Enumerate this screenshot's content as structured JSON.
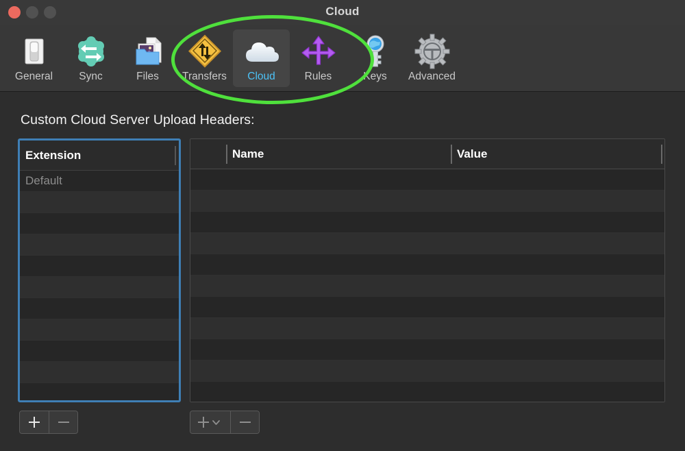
{
  "window": {
    "title": "Cloud",
    "traffic_lights": [
      {
        "name": "close-button",
        "color": "#ec6a5f"
      },
      {
        "name": "minimize-button",
        "color": "#515151"
      },
      {
        "name": "maximize-button",
        "color": "#515151"
      }
    ]
  },
  "toolbar": {
    "tabs": [
      {
        "label": "General",
        "icon": "switch-icon",
        "selected": false
      },
      {
        "label": "Sync",
        "icon": "sync-icon",
        "selected": false
      },
      {
        "label": "Files",
        "icon": "files-icon",
        "selected": false
      },
      {
        "label": "Transfers",
        "icon": "transfers-icon",
        "selected": false
      },
      {
        "label": "Cloud",
        "icon": "cloud-icon",
        "selected": true
      },
      {
        "label": "Rules",
        "icon": "rules-icon",
        "selected": false
      },
      {
        "label": "Keys",
        "icon": "keys-icon",
        "selected": false
      },
      {
        "label": "Advanced",
        "icon": "gear-icon",
        "selected": false
      }
    ],
    "selected_tab_label": "Cloud",
    "selected_tab_text_color": "#4cc2f7"
  },
  "annotation": {
    "shape": "ellipse",
    "color": "#4fe03c",
    "encircles": [
      "Transfers",
      "Cloud",
      "Rules"
    ]
  },
  "main": {
    "section_title": "Custom Cloud Server Upload Headers:",
    "extension_table": {
      "columns": [
        "Extension"
      ],
      "focused": true,
      "focus_ring_color": "#3f7fb5",
      "rows": [
        {
          "extension": "Default"
        },
        {
          "extension": ""
        },
        {
          "extension": ""
        },
        {
          "extension": ""
        },
        {
          "extension": ""
        },
        {
          "extension": ""
        },
        {
          "extension": ""
        },
        {
          "extension": ""
        },
        {
          "extension": ""
        },
        {
          "extension": ""
        },
        {
          "extension": ""
        }
      ]
    },
    "headers_table": {
      "columns": [
        "Name",
        "Value"
      ],
      "rows": [
        {
          "name": "",
          "value": ""
        },
        {
          "name": "",
          "value": ""
        },
        {
          "name": "",
          "value": ""
        },
        {
          "name": "",
          "value": ""
        },
        {
          "name": "",
          "value": ""
        },
        {
          "name": "",
          "value": ""
        },
        {
          "name": "",
          "value": ""
        },
        {
          "name": "",
          "value": ""
        },
        {
          "name": "",
          "value": ""
        },
        {
          "name": "",
          "value": ""
        },
        {
          "name": "",
          "value": ""
        }
      ]
    }
  },
  "footer": {
    "extension_add_label": "+",
    "extension_remove_label": "−",
    "header_add_label": "+",
    "header_add_menu_label": "⌄",
    "header_remove_label": "−"
  }
}
